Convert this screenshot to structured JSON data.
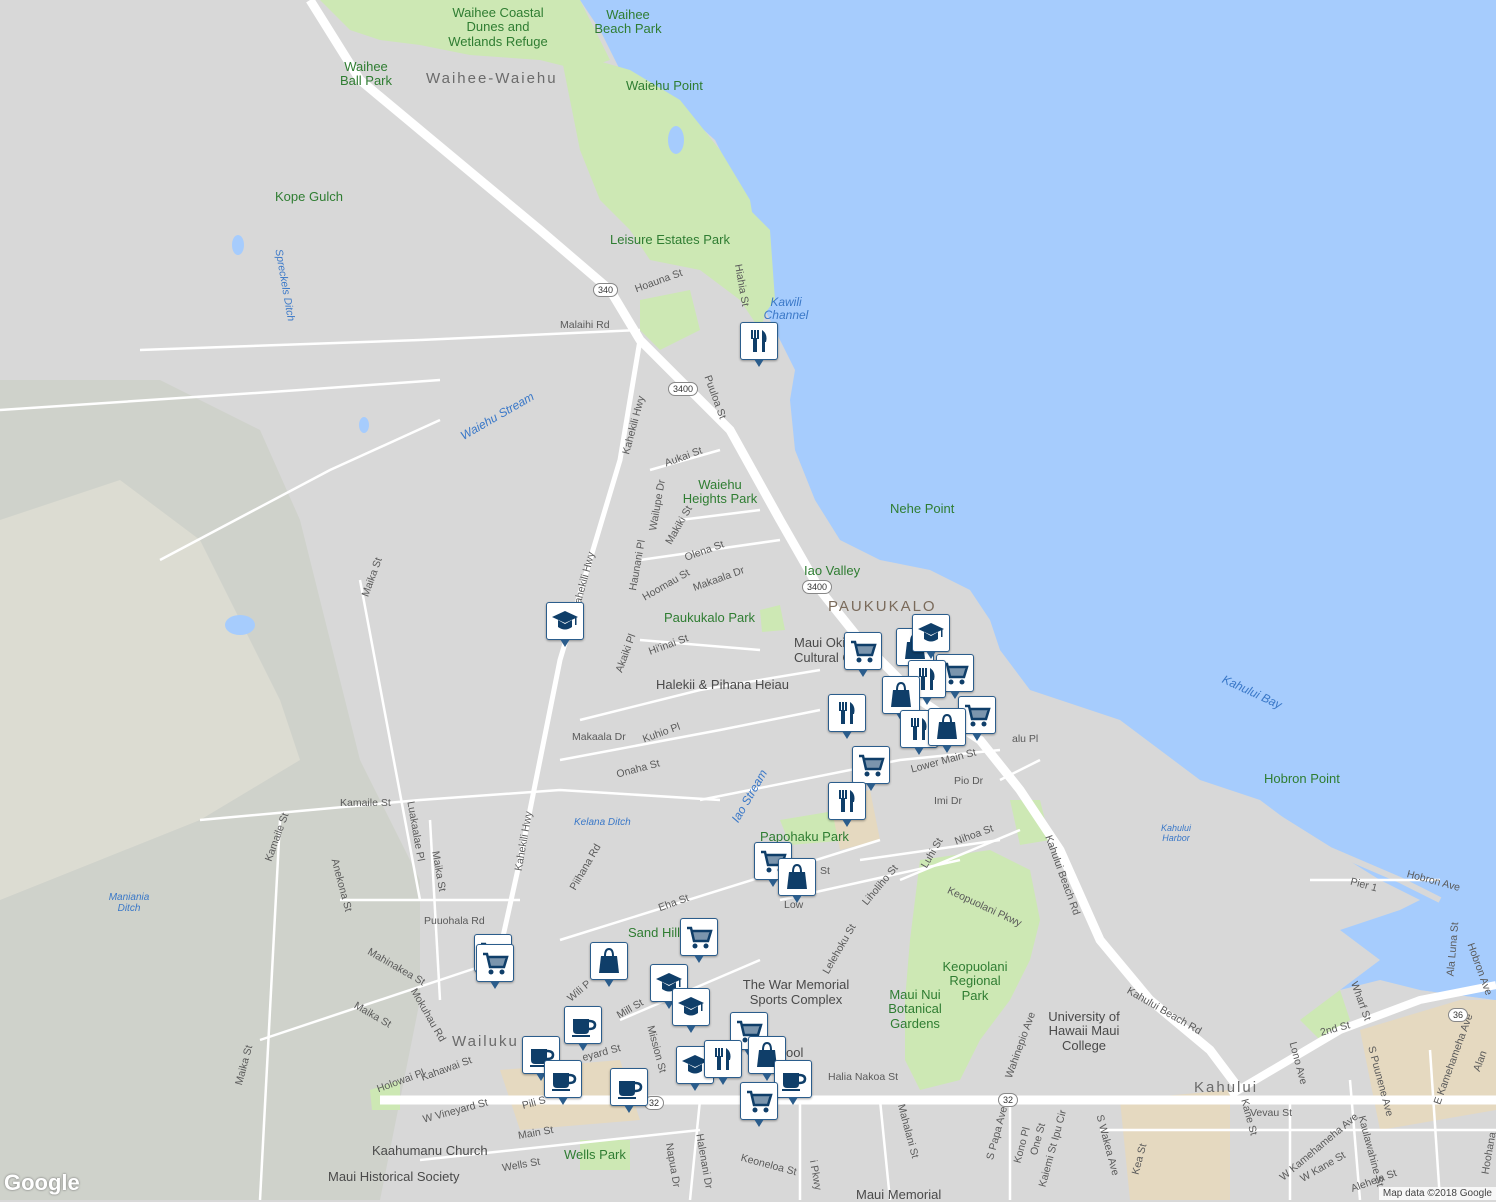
{
  "colors": {
    "land": "#d8d8d8",
    "ocean": "#a6ccfd",
    "park": "#cde8b4",
    "road": "#ffffff",
    "urban": "#e5d9c0",
    "marker_fg": "#0f3e69",
    "marker_border": "#2b5d8c"
  },
  "labels": {
    "waihee_coastal": "Waihee Coastal Dunes and Wetlands Refuge",
    "waihee_beach": "Waihee Beach Park",
    "waihee_ball": "Waihee Ball Park",
    "waihee_waiehu": "Waihee-Waiehu",
    "waiehu_point": "Waiehu Point",
    "kope_gulch": "Kope Gulch",
    "leisure_estates": "Leisure Estates Park",
    "kawili_channel": "Kawili Channel",
    "sprecklels_ditch": "Spreckels Ditch",
    "hoauna": "Hoauna St",
    "malaihi": "Malaihi Rd",
    "malaihi2": "Malaihi Rd",
    "hiahia": "Hiahia St",
    "puuloa": "Puuloa St",
    "kahekili1": "Kahekili Hwy",
    "kahekili2": "Kahekili Hwy",
    "kahekili3": "Kahekili Hwy",
    "waiehu_stream": "Waiehu Stream",
    "aukai": "Aukai St",
    "waiehu_heights": "Waiehu Heights Park",
    "nehe_point": "Nehe Point",
    "wailupe": "Wailupe Dr",
    "makiki": "Makiki St",
    "olena": "Olena St",
    "haunani": "Haunani Pl",
    "hoomau": "Hoomau St",
    "makaala_dr": "Makaala Dr",
    "iao_valley": "Iao Valley",
    "paukukalo": "PAUKUKALO",
    "paukukalo_park": "Paukukalo Park",
    "maui_cultural": "Maui Oki Cultural C",
    "akaiki": "Akaiki Pl",
    "hiinai": "Hi'inai St",
    "halekii": "Halekii & Pihana Heiau",
    "kahului_bay": "Kahului Bay",
    "makaala_dr2": "Makaala Dr",
    "kuhio": "Kuhio Pl",
    "onaha": "Onaha St",
    "iao_stream": "Iao Stream",
    "lower_main": "Lower Main St",
    "pio": "Pio Dr",
    "imi": "Imi Dr",
    "lalu": "alu Pl",
    "hobron_point": "Hobron Point",
    "kahului_harbor": "Kahului Harbor",
    "maika1": "Maika St",
    "kamaile": "Kamaile St",
    "luakaalae": "Luakaalae Pl",
    "kelana_ditch": "Kelana Ditch",
    "papohaku": "Papohaku Park",
    "nihoa": "Nihoa St",
    "luhi": "Luhi St",
    "kahului_beach1": "Kahului Beach Rd",
    "hobron_ave": "Hobron Ave",
    "pier1": "Pier 1",
    "kamaile2": "Kamaile St",
    "anekona": "Anekona St",
    "maika2": "Maika St",
    "maniania": "Maniania Ditch",
    "piihana": "Piihana Rd",
    "eha": "Eha St",
    "lihoiho": "Liholiho St",
    "keopuolani_pkwy": "Keopuolani Pkwy",
    "puuohala": "Puuohala Rd",
    "sand_hills": "Sand Hill",
    "mahinakea": "Mahinakea St",
    "war_memorial": "The War Memorial Sports Complex",
    "lelehoku": "Lelehoku St",
    "keopuolani_park": "Keopuolani Regional Park",
    "maui_nui": "Maui Nui Botanical Gardens",
    "ala_luna": "Ala Luna St",
    "hobron_ave2": "Hobron Ave",
    "mokuhau": "Mokuhau Rd",
    "maika3": "Maika St",
    "wili": "Wili P",
    "mill": "Mill St",
    "kahului_beach2": "Kahului Beach Rd",
    "wharf": "Wharf St",
    "uh_maui": "University of Hawaii Maui College",
    "wahinepio": "Wahinepio Ave",
    "second": "2nd St",
    "mission": "Mission St",
    "wailuku": "Wailuku",
    "kahawai": "Kahawai St",
    "vineyard": "eyard St",
    "school": "ool",
    "halia": "Halia Nakoa St",
    "kahului": "Kahului",
    "lono": "Lono Ave",
    "s_puunene": "S Puunene Ave",
    "e_kamehameha": "E Kamehameha Ave",
    "alamaile": "Alan",
    "maika4": "Maika St",
    "holowai": "Holowai Pl",
    "pili": "Pili S",
    "w_vineyard": "W Vineyard St",
    "mahalani": "Mahalani St",
    "s_papa": "S Papa Ave",
    "kono": "Kono Pl",
    "ipu": "Ipu Cir",
    "one": "One St",
    "kaiemi": "Kaiemi St",
    "s_wakea": "S Wakea Ave",
    "kea": "Kea St",
    "kane": "Kane St",
    "vevau": "Vevau St",
    "w_kamehameha": "W Kamehameha Ave",
    "kaulawahine": "Kaulawahine St",
    "w_kane": "W Kane St",
    "alehela": "Alehela St",
    "kaahumanu": "Kaahumanu Church",
    "main": "Main St",
    "wells": "Wells St",
    "wells_park": "Wells Park",
    "maui_historical": "Maui Historical Society",
    "napua": "Napua Dr",
    "halenani": "Halenani Dr",
    "keoneloa": "Keoneloa St",
    "kuikahi": "i Pkwy",
    "maui_memorial": "Maui Memorial",
    "hoohana": "Hoohana",
    "low": "Low",
    "st": "St"
  },
  "shields": [
    "340",
    "3400",
    "3400",
    "32",
    "32",
    "36"
  ],
  "attribution": "Map data ©2018 Google",
  "logo": "Google",
  "markers": [
    {
      "icon": "restaurant-icon"
    },
    {
      "icon": "school-icon"
    },
    {
      "icon": "grocery-icon"
    },
    {
      "icon": "shopping-icon"
    },
    {
      "icon": "school-icon"
    },
    {
      "icon": "grocery-icon"
    },
    {
      "icon": "restaurant-icon"
    },
    {
      "icon": "shopping-icon"
    },
    {
      "icon": "grocery-icon"
    },
    {
      "icon": "restaurant-icon"
    },
    {
      "icon": "restaurant-icon"
    },
    {
      "icon": "shopping-icon"
    },
    {
      "icon": "grocery-icon"
    },
    {
      "icon": "restaurant-icon"
    },
    {
      "icon": "grocery-icon"
    },
    {
      "icon": "shopping-icon"
    },
    {
      "icon": "grocery-icon"
    },
    {
      "icon": "grocery-icon"
    },
    {
      "icon": "shopping-icon"
    },
    {
      "icon": "school-icon"
    },
    {
      "icon": "school-icon"
    },
    {
      "icon": "cafe-icon"
    },
    {
      "icon": "cafe-icon"
    },
    {
      "icon": "cafe-icon"
    },
    {
      "icon": "cafe-icon"
    },
    {
      "icon": "grocery-icon"
    },
    {
      "icon": "school-icon"
    },
    {
      "icon": "shopping-icon"
    },
    {
      "icon": "cafe-icon"
    },
    {
      "icon": "grocery-icon"
    },
    {
      "icon": "restaurant-icon"
    },
    {
      "icon": "grocery-icon"
    }
  ]
}
